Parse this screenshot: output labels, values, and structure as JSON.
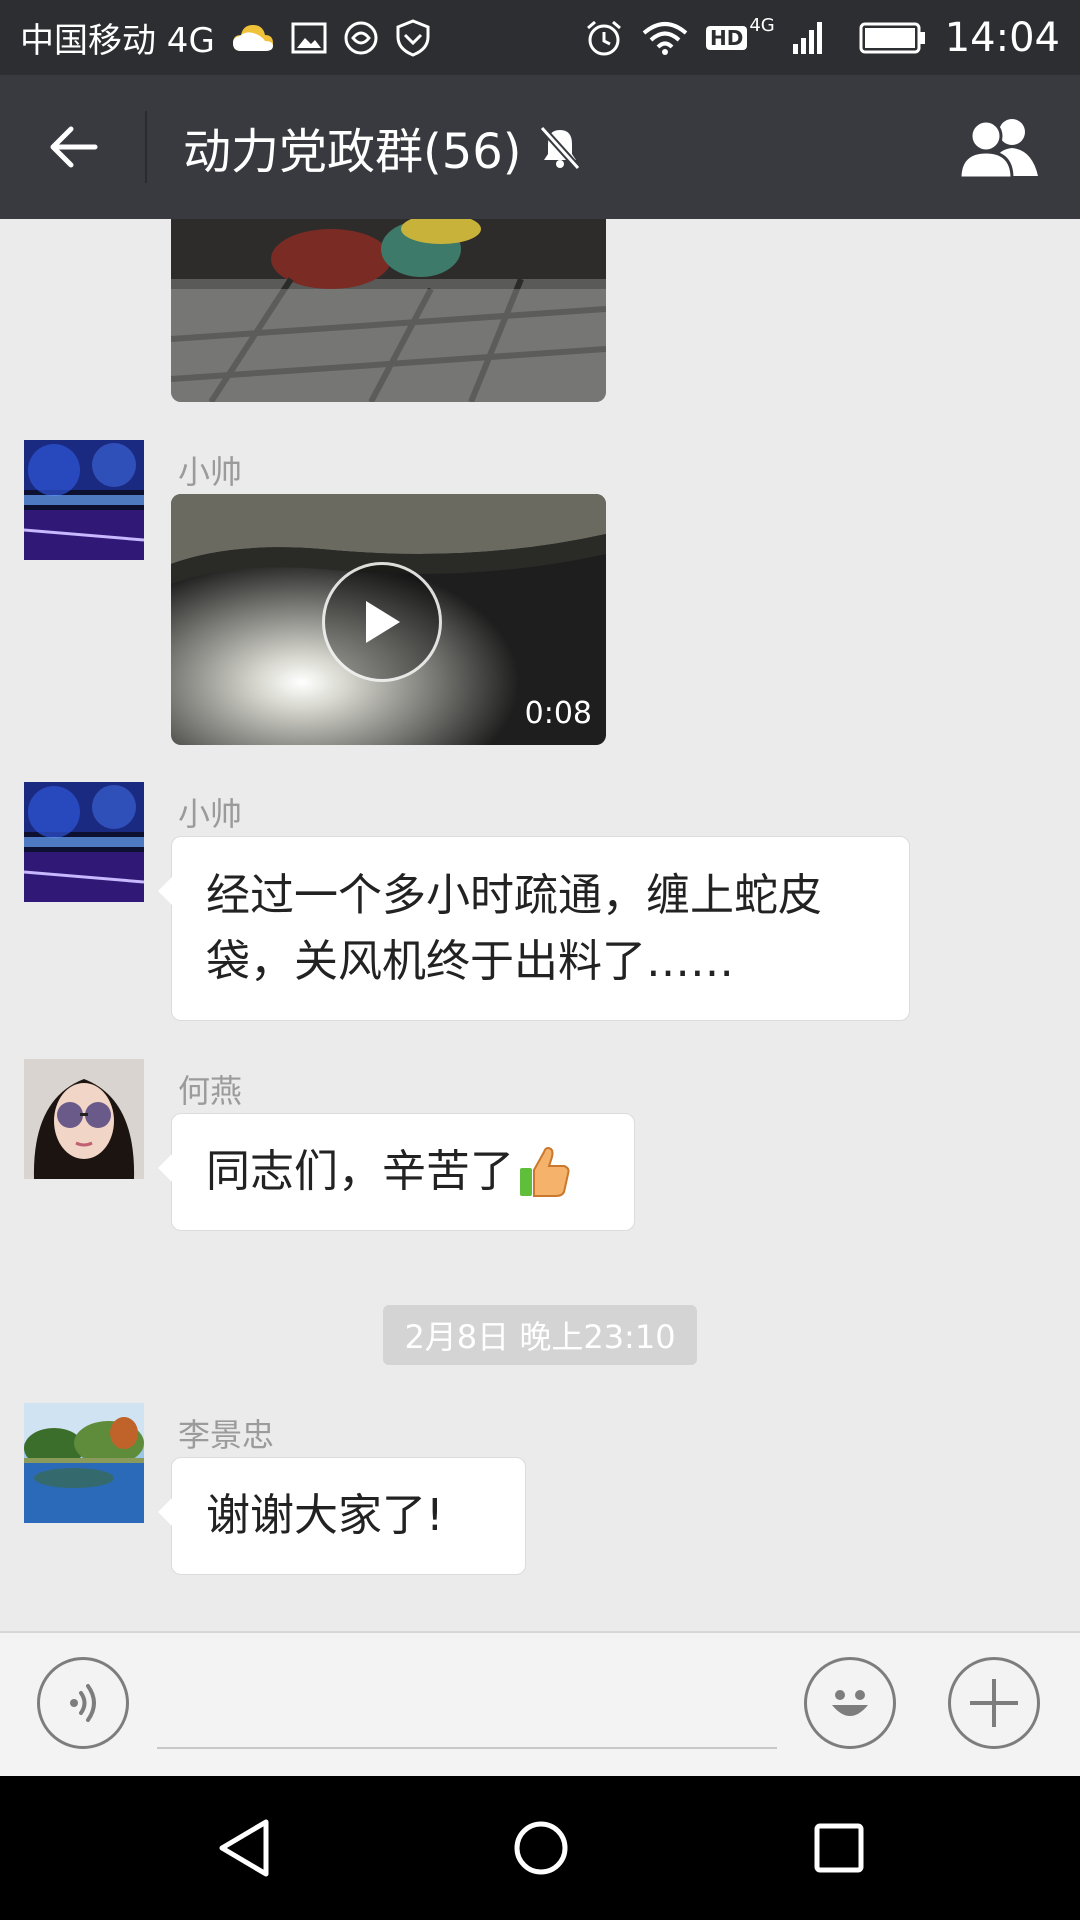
{
  "status_bar": {
    "carrier": "中国移动 4G",
    "time": "14:04",
    "icons": [
      "cloud-icon",
      "gallery-icon",
      "sync-icon",
      "shield-icon",
      "alarm-icon",
      "wifi-icon",
      "hd-icon",
      "signal-icon",
      "battery-icon"
    ],
    "hd_label": "HD",
    "network_label": "4G"
  },
  "header": {
    "title": "动力党政群(56)",
    "back_icon": "back-arrow-icon",
    "mute_icon": "bell-off-icon",
    "members_icon": "group-members-icon",
    "background": "#393a3f"
  },
  "messages": [
    {
      "type": "image",
      "sender": ""
    },
    {
      "type": "video",
      "sender": "小帅",
      "duration": "0:08",
      "play_icon": "play-icon"
    },
    {
      "type": "text",
      "sender": "小帅",
      "text_line1": "经过一个多小时疏通，缠上蛇皮",
      "text_line2": "袋，关风机终于出料了……"
    },
    {
      "type": "text",
      "sender": "何燕",
      "text": "同志们，辛苦了",
      "emoji": "thumbs-up-icon"
    },
    {
      "type": "timestamp",
      "text": "2月8日 晚上23:10"
    },
    {
      "type": "text",
      "sender": "李景忠",
      "text": "谢谢大家了!"
    }
  ],
  "input_bar": {
    "voice_icon": "voice-icon",
    "emoji_icon": "emoji-icon",
    "more_icon": "plus-icon",
    "input_value": ""
  },
  "nav_bar": {
    "back_icon": "nav-back-icon",
    "home_icon": "nav-home-icon",
    "recents_icon": "nav-recents-icon"
  }
}
